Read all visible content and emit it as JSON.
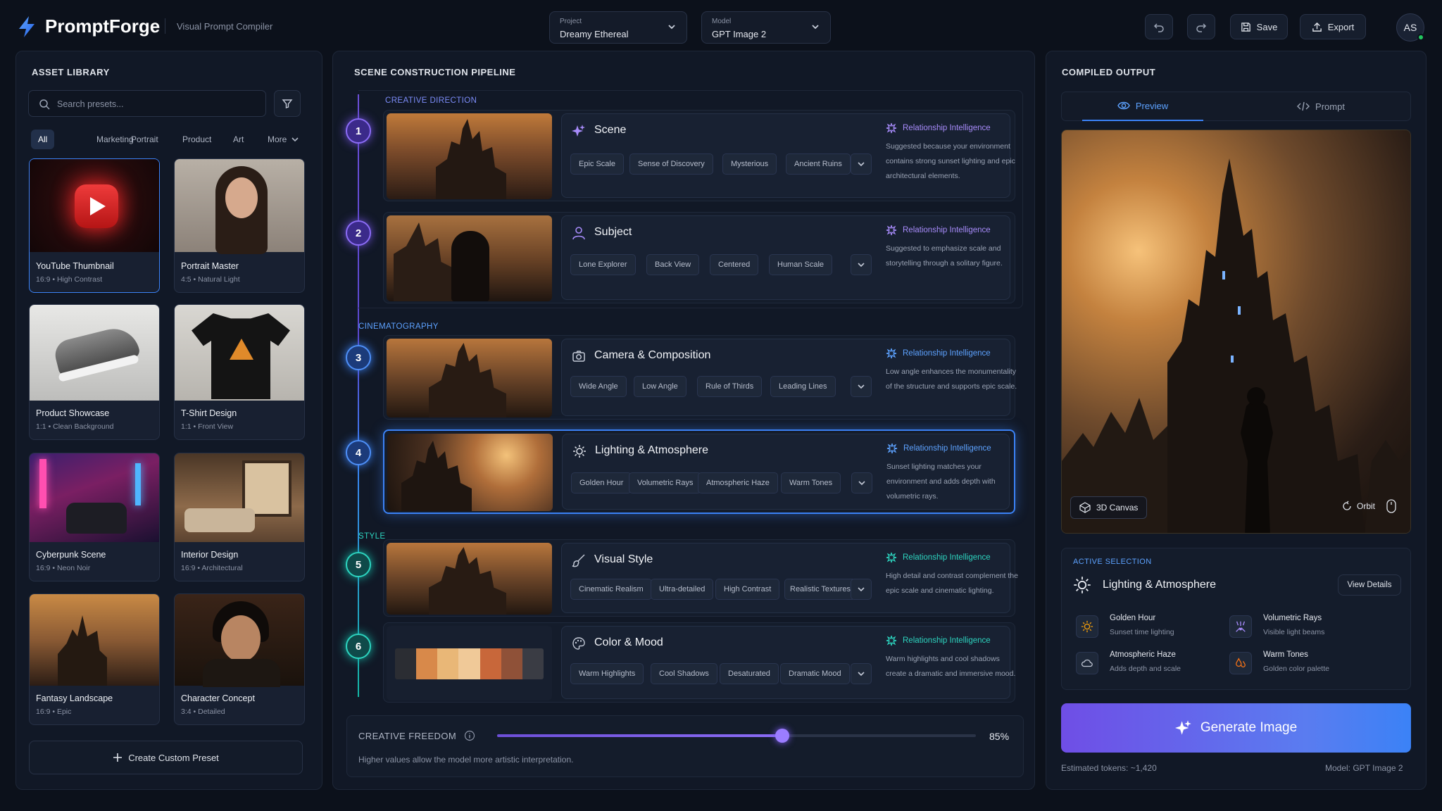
{
  "app": {
    "name": "PromptForge",
    "subtitle": "Visual Prompt Compiler",
    "user_initials": "AS"
  },
  "header": {
    "project": {
      "label": "Project",
      "value": "Dreamy Ethereal"
    },
    "model": {
      "label": "Model",
      "value": "GPT Image 2"
    },
    "save": "Save",
    "export": "Export"
  },
  "library": {
    "title": "ASSET LIBRARY",
    "search_placeholder": "Search presets...",
    "filters": [
      "All",
      "Marketing",
      "Portrait",
      "Product",
      "Art",
      "More"
    ],
    "presets": [
      {
        "title": "YouTube Thumbnail",
        "sub": "16:9  •  High Contrast"
      },
      {
        "title": "Portrait Master",
        "sub": "4:5  •  Natural Light"
      },
      {
        "title": "Product Showcase",
        "sub": "1:1  •  Clean Background"
      },
      {
        "title": "T-Shirt Design",
        "sub": "1:1  •  Front View"
      },
      {
        "title": "Cyberpunk Scene",
        "sub": "16:9  •  Neon Noir"
      },
      {
        "title": "Interior Design",
        "sub": "16:9  •  Architectural"
      },
      {
        "title": "Fantasy Landscape",
        "sub": "16:9  •  Epic"
      },
      {
        "title": "Character Concept",
        "sub": "3:4  •  Detailed"
      }
    ],
    "create_label": "Create Custom Preset"
  },
  "pipeline": {
    "title": "SCENE CONSTRUCTION PIPELINE",
    "sections": [
      "CREATIVE DIRECTION",
      "CINEMATOGRAPHY",
      "STYLE"
    ],
    "ri_label": "Relationship Intelligence",
    "steps": [
      {
        "num": "1",
        "name": "Scene",
        "chips": [
          "Epic Scale",
          "Sense of Discovery",
          "Mysterious",
          "Ancient Ruins"
        ],
        "ri_text": "Suggested because your environment contains strong sunset lighting and epic architectural elements."
      },
      {
        "num": "2",
        "name": "Subject",
        "chips": [
          "Lone Explorer",
          "Back View",
          "Centered",
          "Human Scale"
        ],
        "ri_text": "Suggested to emphasize scale and storytelling through a solitary figure."
      },
      {
        "num": "3",
        "name": "Camera & Composition",
        "chips": [
          "Wide Angle",
          "Low Angle",
          "Rule of Thirds",
          "Leading Lines"
        ],
        "ri_text": "Low angle enhances the monumentality of the structure and supports epic scale."
      },
      {
        "num": "4",
        "name": "Lighting & Atmosphere",
        "chips": [
          "Golden Hour",
          "Volumetric Rays",
          "Atmospheric Haze",
          "Warm Tones"
        ],
        "ri_text": "Sunset lighting matches your environment and adds depth with volumetric rays."
      },
      {
        "num": "5",
        "name": "Visual Style",
        "chips": [
          "Cinematic Realism",
          "Ultra-detailed",
          "High Contrast",
          "Realistic Textures"
        ],
        "ri_text": "High detail and contrast complement the epic scale and cinematic lighting."
      },
      {
        "num": "6",
        "name": "Color & Mood",
        "chips": [
          "Warm Highlights",
          "Cool Shadows",
          "Desaturated",
          "Dramatic Mood"
        ],
        "ri_text": "Warm highlights and cool shadows create a dramatic and immersive mood."
      }
    ],
    "palette": [
      "#2b2d33",
      "#d8894a",
      "#e9b777",
      "#f0c998",
      "#c8673a",
      "#8f5138",
      "#3a3c44"
    ],
    "freedom": {
      "label": "CREATIVE FREEDOM",
      "value": 0.85,
      "value_text": "85%",
      "hint": "Higher values allow the model more artistic interpretation."
    }
  },
  "output": {
    "title": "COMPILED OUTPUT",
    "tabs": [
      "Preview",
      "Prompt"
    ],
    "canvas_label": "3D Canvas",
    "orbit_label": "Orbit",
    "active": {
      "label": "ACTIVE SELECTION",
      "name": "Lighting & Atmosphere",
      "view_details": "View Details",
      "items": [
        {
          "title": "Golden Hour",
          "sub": "Sunset time lighting"
        },
        {
          "title": "Volumetric Rays",
          "sub": "Visible light beams"
        },
        {
          "title": "Atmospheric Haze",
          "sub": "Adds depth and scale"
        },
        {
          "title": "Warm Tones",
          "sub": "Golden color palette"
        }
      ]
    },
    "generate": "Generate Image",
    "tokens": "Estimated tokens: ~1,420",
    "model_note": "Model: GPT Image 2"
  },
  "colors": {
    "accent": "#7c5cf0",
    "blue": "#3b82f6",
    "teal": "#14b8a6",
    "bg": "#0c111b"
  }
}
